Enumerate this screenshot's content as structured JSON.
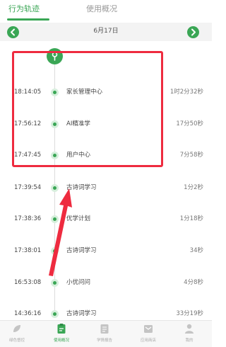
{
  "tabs": [
    {
      "label": "行为轨迹",
      "active": true
    },
    {
      "label": "使用概况",
      "active": false
    }
  ],
  "date_bar": {
    "date": "6月17日"
  },
  "timeline": [
    {
      "time": "18:14:05",
      "label": "家长管理中心",
      "duration": "1时2分32秒"
    },
    {
      "time": "17:56:12",
      "label": "AI精准学",
      "duration": "17分50秒"
    },
    {
      "time": "17:47:45",
      "label": "用户中心",
      "duration": "7分58秒"
    },
    {
      "time": "17:39:54",
      "label": "古诗词学习",
      "duration": "1分2秒"
    },
    {
      "time": "17:38:36",
      "label": "优学计划",
      "duration": "1分18秒"
    },
    {
      "time": "17:38:01",
      "label": "古诗词学习",
      "duration": "34秒"
    },
    {
      "time": "16:53:08",
      "label": "小优问问",
      "duration": "4分8秒"
    },
    {
      "time": "14:36:16",
      "label": "古诗词学习",
      "duration": "33分19秒"
    }
  ],
  "stray": "• • •",
  "bottom_nav": [
    {
      "label": "绿色督控",
      "icon": "leaf-icon",
      "active": false
    },
    {
      "label": "使用概况",
      "icon": "clipboard-icon",
      "active": true
    },
    {
      "label": "学情报告",
      "icon": "report-icon",
      "active": false
    },
    {
      "label": "应用商店",
      "icon": "store-icon",
      "active": false
    },
    {
      "label": "我的",
      "icon": "user-icon",
      "active": false
    }
  ],
  "colors": {
    "accent": "#3aa655",
    "highlight": "#ee2b3f",
    "arrow": "#ee2b3f"
  }
}
